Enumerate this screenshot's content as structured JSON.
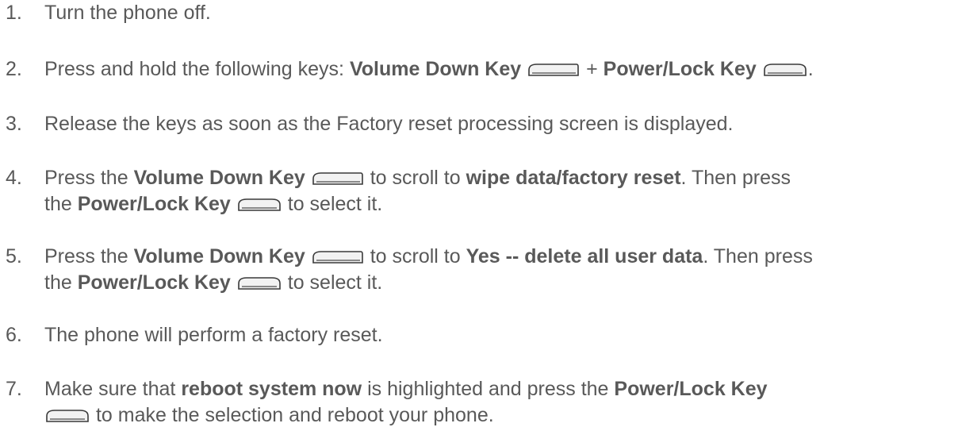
{
  "steps": [
    {
      "num": "1.",
      "parts": [
        {
          "t": "Turn the phone off."
        }
      ]
    },
    {
      "num": "2.",
      "parts": [
        {
          "t": "Press and hold the following keys: "
        },
        {
          "b": "Volume Down Key"
        },
        {
          "t": " "
        },
        {
          "key": "volume"
        },
        {
          "t": " + "
        },
        {
          "b": "Power/Lock Key"
        },
        {
          "t": " "
        },
        {
          "key": "power"
        },
        {
          "t": "."
        }
      ]
    },
    {
      "num": "3.",
      "parts": [
        {
          "t": "Release the keys as soon as the Factory reset processing screen is displayed."
        }
      ]
    },
    {
      "num": "4.",
      "parts": [
        {
          "t": "Press the "
        },
        {
          "b": "Volume Down Key"
        },
        {
          "t": " "
        },
        {
          "key": "volume"
        },
        {
          "t": " to scroll to "
        },
        {
          "b": "wipe data/factory reset"
        },
        {
          "t": ". Then press "
        },
        {
          "br": true
        },
        {
          "t": "the "
        },
        {
          "b": "Power/Lock Key"
        },
        {
          "t": " "
        },
        {
          "key": "power"
        },
        {
          "t": " to select it."
        }
      ]
    },
    {
      "num": "5.",
      "parts": [
        {
          "t": "Press the "
        },
        {
          "b": "Volume Down Key"
        },
        {
          "t": " "
        },
        {
          "key": "volume"
        },
        {
          "t": " to scroll to "
        },
        {
          "b": "Yes -- delete all user data"
        },
        {
          "t": ". Then press "
        },
        {
          "br": true
        },
        {
          "t": "the "
        },
        {
          "b": "Power/Lock Key"
        },
        {
          "t": " "
        },
        {
          "key": "power"
        },
        {
          "t": " to select it."
        }
      ]
    },
    {
      "num": "6.",
      "parts": [
        {
          "t": "The phone will perform a factory reset."
        }
      ]
    },
    {
      "num": "7.",
      "parts": [
        {
          "t": "Make sure that "
        },
        {
          "b": "reboot system now"
        },
        {
          "t": " is highlighted and press the "
        },
        {
          "b": "Power/Lock Key"
        },
        {
          "br": true
        },
        {
          "key": "power"
        },
        {
          "t": " to make the selection and reboot your phone."
        }
      ]
    }
  ],
  "icons": {
    "volume": "volume-down-key-icon",
    "power": "power-lock-key-icon"
  }
}
